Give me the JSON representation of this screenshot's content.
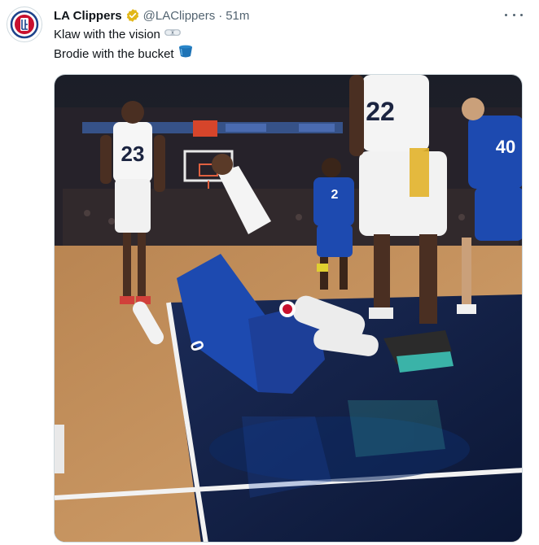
{
  "tweet": {
    "author": {
      "display_name": "LA Clippers",
      "handle": "@LAClippers",
      "verified_badge": "gold-check-icon",
      "avatar": "la-clippers-logo"
    },
    "separator": "·",
    "timestamp": "51m",
    "text_lines": [
      {
        "text": "Klaw with the vision",
        "emoji": "goggles-icon"
      },
      {
        "text": "Brodie with the bucket",
        "emoji": "bucket-icon"
      }
    ],
    "more_icon": "more-options-icon",
    "media": {
      "kind": "video-still",
      "description_icon": "basketball-game-photo",
      "jersey_numbers": {
        "ref_left": "23",
        "ref_right": "22",
        "opponent_mid": "2",
        "clipper_right": "40",
        "clipper_fallen": "0"
      }
    }
  },
  "colors": {
    "brand_red": "#c8102e",
    "brand_blue": "#1d428a",
    "verified_gold": "#e2b719",
    "court_wood": "#c99a66",
    "paint_navy": "#0f1d3f"
  }
}
